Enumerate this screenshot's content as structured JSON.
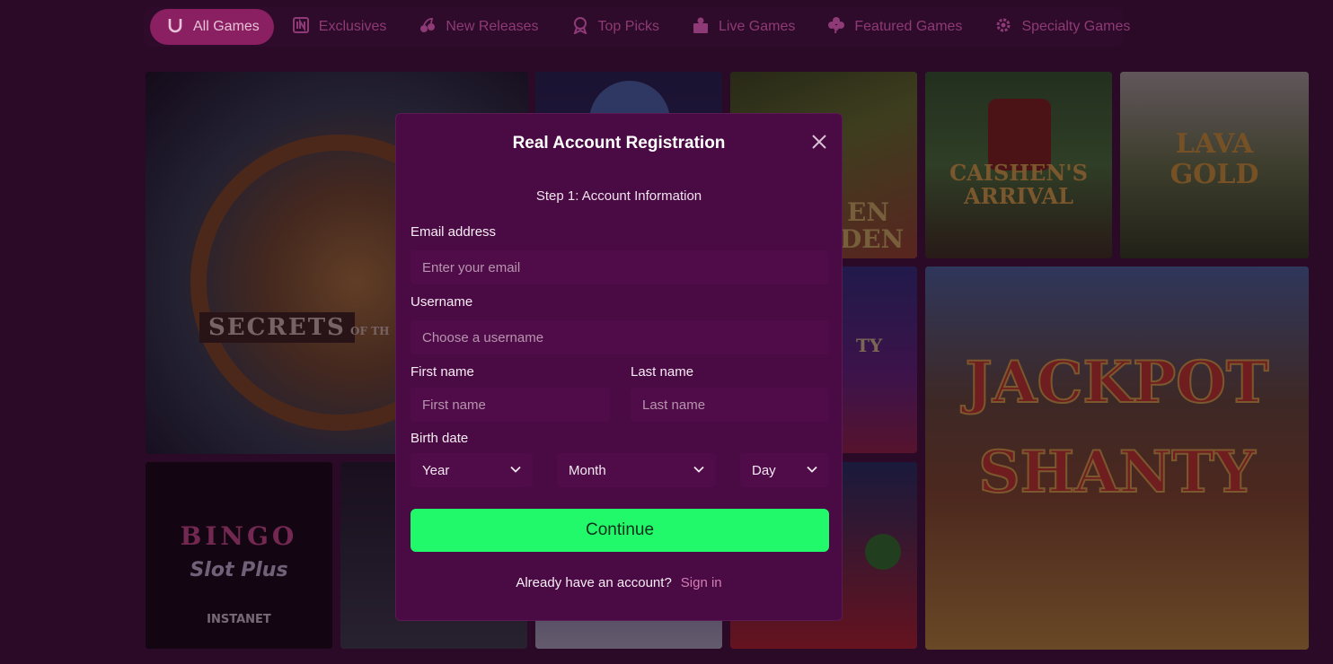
{
  "nav": {
    "items": [
      {
        "label": "All Games",
        "icon": "horseshoe-icon"
      },
      {
        "label": "Exclusives",
        "icon": "exclusive-icon"
      },
      {
        "label": "New Releases",
        "icon": "cherries-icon"
      },
      {
        "label": "Top Picks",
        "icon": "award-icon"
      },
      {
        "label": "Live Games",
        "icon": "dealer-icon"
      },
      {
        "label": "Featured Games",
        "icon": "clover-icon"
      },
      {
        "label": "Specialty Games",
        "icon": "gear-icon"
      }
    ]
  },
  "games": {
    "secrets": "SECRETS",
    "secrets_sub": "OF TH",
    "caishens": "CAISHEN'S ARRIVAL",
    "lava": "LAVA GOLD",
    "jackpot": "JACKPOT SHANTY",
    "bingo": "BINGO",
    "bingo_sub": "Slot Plus",
    "instanet": "INSTANET",
    "garden_1": "EN",
    "garden_2": "DEN",
    "vegas": "TY"
  },
  "modal": {
    "title": "Real Account Registration",
    "step": "Step 1: Account Information",
    "email_label": "Email address",
    "email_placeholder": "Enter your email",
    "username_label": "Username",
    "username_placeholder": "Choose a username",
    "first_label": "First name",
    "first_placeholder": "First name",
    "last_label": "Last name",
    "last_placeholder": "Last name",
    "birth_label": "Birth date",
    "year": "Year",
    "month": "Month",
    "day": "Day",
    "continue": "Continue",
    "have_account": "Already have an account?",
    "sign_in": "Sign in"
  },
  "colors": {
    "background": "#2a0a26",
    "modal": "#4a0a44",
    "accent_green": "#21f96b",
    "nav_active": "#8a1f62",
    "link": "#d37fb3"
  }
}
